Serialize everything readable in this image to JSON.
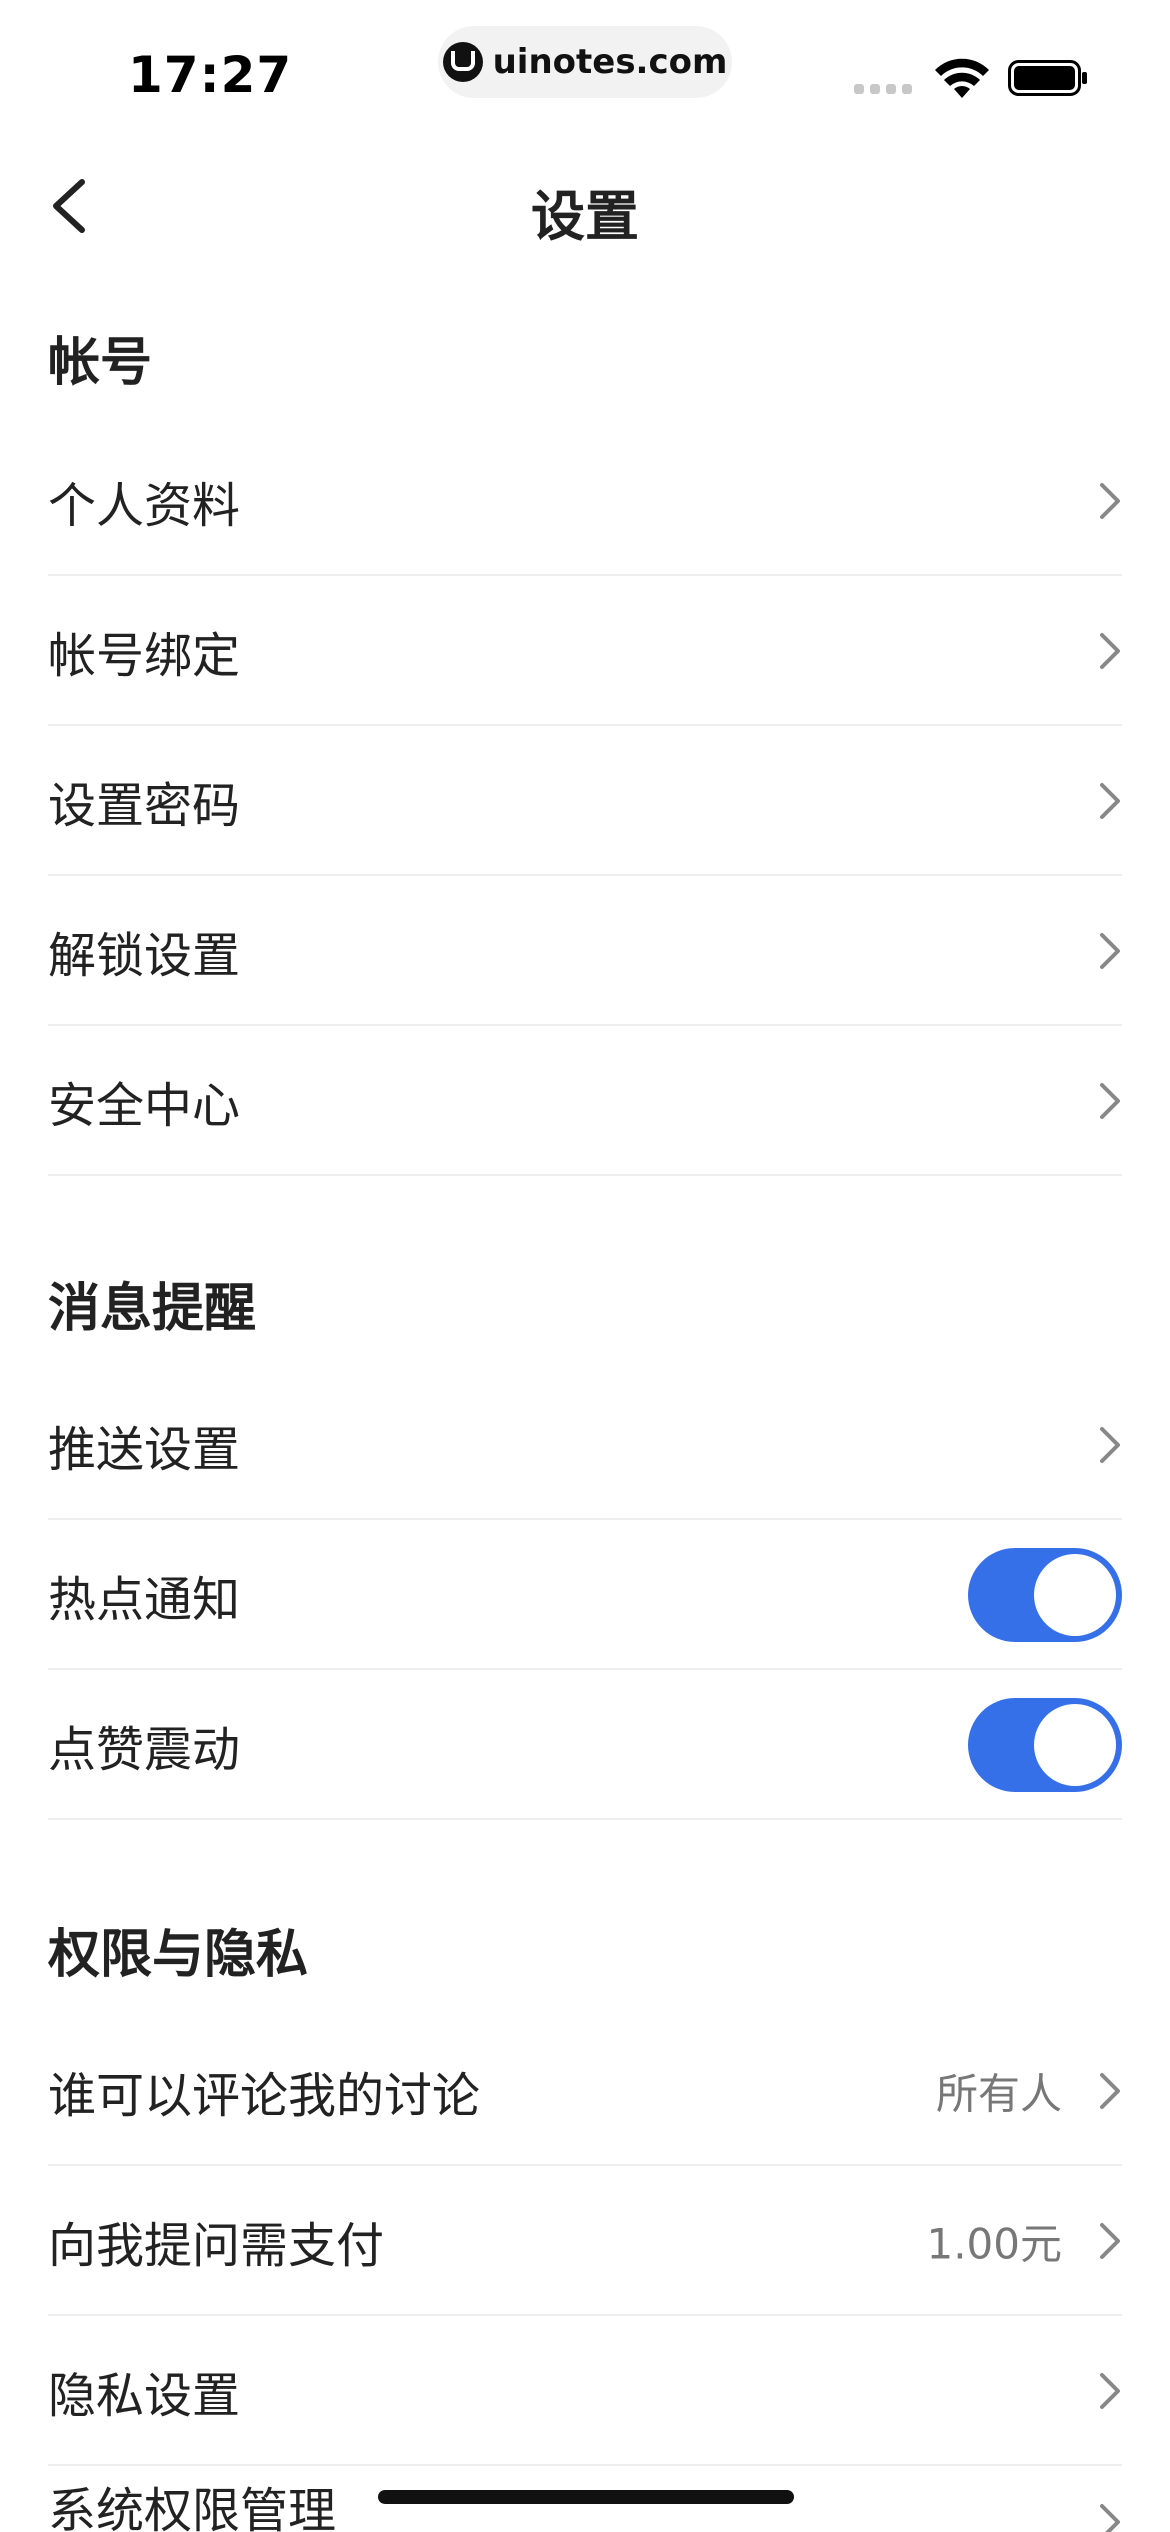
{
  "status_bar": {
    "time": "17:27",
    "url": "uinotes.com"
  },
  "nav": {
    "title": "设置"
  },
  "sections": [
    {
      "title": "帐号",
      "items": [
        {
          "label": "个人资料"
        },
        {
          "label": "帐号绑定"
        },
        {
          "label": "设置密码"
        },
        {
          "label": "解锁设置"
        },
        {
          "label": "安全中心"
        }
      ]
    },
    {
      "title": "消息提醒",
      "items": [
        {
          "label": "推送设置"
        },
        {
          "label": "热点通知",
          "toggle": true
        },
        {
          "label": "点赞震动",
          "toggle": true
        }
      ]
    },
    {
      "title": "权限与隐私",
      "items": [
        {
          "label": "谁可以评论我的讨论",
          "value": "所有人"
        },
        {
          "label": "向我提问需支付",
          "value": "1.00元"
        },
        {
          "label": "隐私设置"
        },
        {
          "label": "系统权限管理"
        }
      ]
    }
  ],
  "colors": {
    "accent": "#3570e8",
    "divider": "#efefef",
    "text": "#222222",
    "secondary": "#777777"
  }
}
